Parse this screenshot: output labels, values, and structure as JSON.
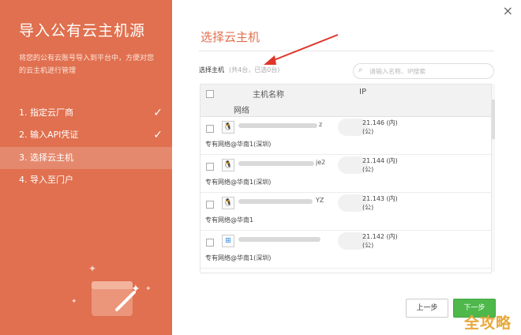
{
  "sidebar": {
    "title": "导入公有云主机源",
    "description": "将您的公有云账号导入到平台中，方便对您的云主机进行管理",
    "steps": [
      {
        "label": "1. 指定云厂商",
        "done": true
      },
      {
        "label": "2. 输入API凭证",
        "done": true
      },
      {
        "label": "3. 选择云主机",
        "done": false,
        "active": true
      },
      {
        "label": "4. 导入至门户",
        "done": false
      }
    ],
    "check_glyph": "✓"
  },
  "dialog": {
    "close_glyph": "×",
    "title": "选择云主机",
    "select_label": "选择主机",
    "select_count": "(共4台，已选0台)",
    "search_placeholder": "请输入名称、IP搜索",
    "search_icon": "search-icon"
  },
  "table": {
    "col_name": "主机名称",
    "col_ip": "IP",
    "col_network": "网络",
    "rows": [
      {
        "name_suffix": "z",
        "ip_private": "21.146 (内)",
        "ip_public": "(公)",
        "network": "专有网络@华南1(深圳)",
        "os_icon": "linux-icon"
      },
      {
        "name_suffix": "je2",
        "ip_private": "21.144 (内)",
        "ip_public": "(公)",
        "network": "专有网络@华南1(深圳)",
        "os_icon": "linux-icon"
      },
      {
        "name_suffix": "YZ",
        "ip_private": "21.143 (内)",
        "ip_public": "(公)",
        "network": "专有网络@华南1",
        "os_icon": "linux-icon"
      },
      {
        "name_suffix": "",
        "ip_private": "21.142 (内)",
        "ip_public": "(公)",
        "network": "专有网络@华南1(深圳)",
        "os_icon": "windows-icon"
      }
    ]
  },
  "buttons": {
    "prev": "上一步",
    "next": "下一步"
  },
  "watermark": "全攻略",
  "colors": {
    "accent": "#e0704f",
    "next_button": "#4eb84b",
    "arrow": "#e0342a"
  }
}
